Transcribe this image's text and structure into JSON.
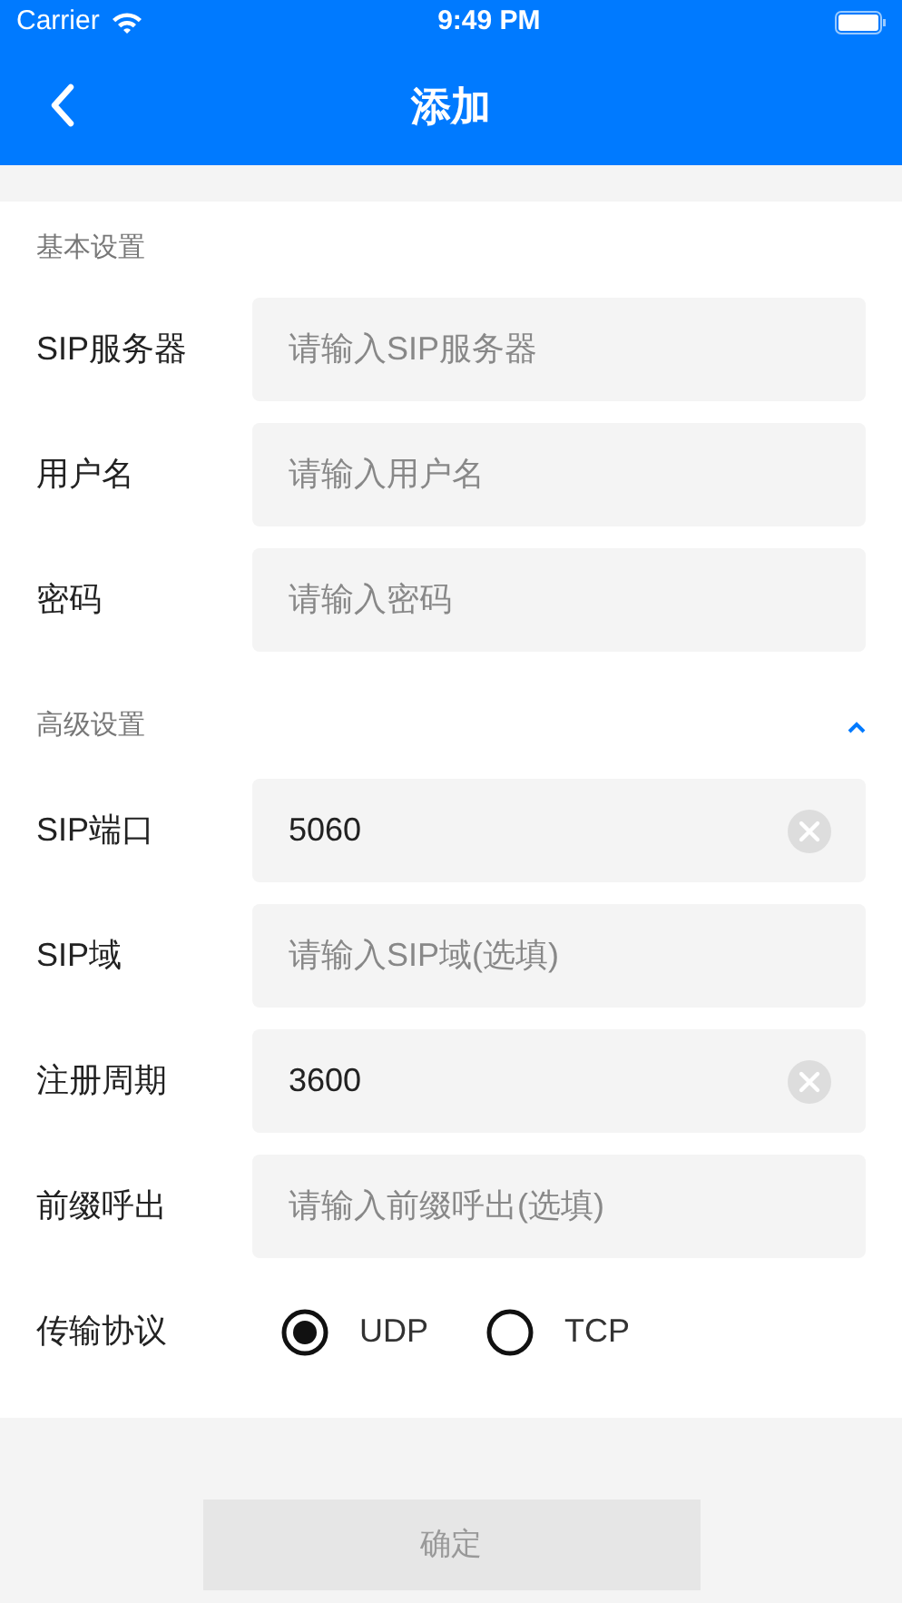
{
  "status_bar": {
    "carrier": "Carrier",
    "time": "9:49 PM"
  },
  "nav": {
    "title": "添加"
  },
  "sections": [
    {
      "title": "基本设置",
      "rows": [
        {
          "kind": "field",
          "label": "SIP服务器",
          "placeholder": "请输入SIP服务器"
        },
        {
          "kind": "field",
          "label": "用户名",
          "placeholder": "请输入用户名"
        },
        {
          "kind": "field",
          "label": "密码",
          "placeholder": "请输入密码"
        }
      ]
    },
    {
      "title": "高级设置",
      "collapsible": true,
      "expanded": true,
      "rows": [
        {
          "kind": "field",
          "label": "SIP端口",
          "value": "5060"
        },
        {
          "kind": "field",
          "label": "SIP域",
          "placeholder": "请输入SIP域(选填)"
        },
        {
          "kind": "field",
          "label": "注册周期",
          "value": "3600"
        },
        {
          "kind": "field",
          "label": "前缀呼出",
          "placeholder": "请输入前缀呼出(选填)"
        },
        {
          "kind": "radio",
          "label": "传输协议",
          "options": [
            {
              "label": "UDP",
              "selected": true
            },
            {
              "label": "TCP",
              "selected": false
            }
          ]
        }
      ]
    }
  ],
  "submit": {
    "label": "确定",
    "disabled": true
  }
}
